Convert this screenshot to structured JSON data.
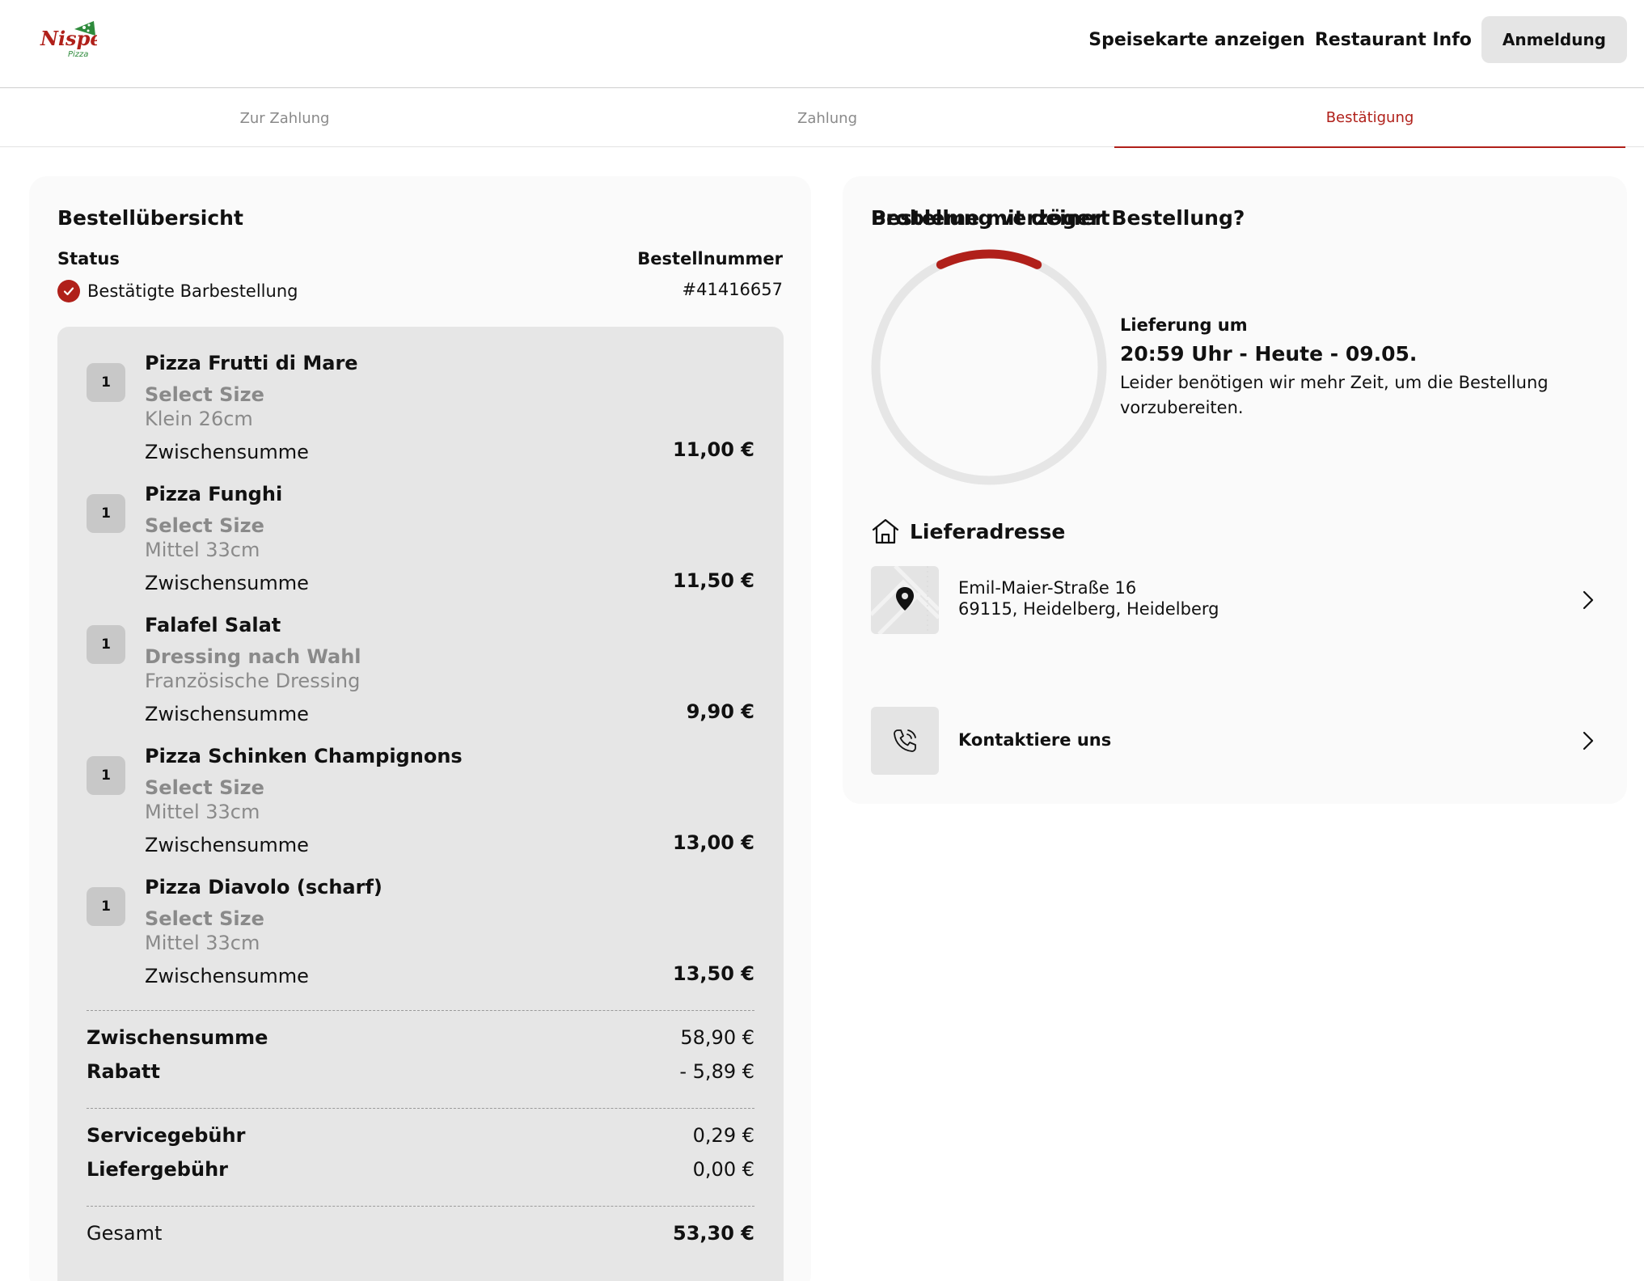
{
  "brand": {
    "logo_text": "Nispet",
    "logo_subtext": "Pizza",
    "accent": "#b0201a"
  },
  "header": {
    "nav": [
      "Speisekarte anzeigen",
      "Restaurant Info"
    ],
    "login_label": "Anmeldung"
  },
  "steps": [
    {
      "label": "Zur Zahlung",
      "active": false
    },
    {
      "label": "Zahlung",
      "active": false
    },
    {
      "label": "Bestätigung",
      "active": true
    }
  ],
  "order": {
    "title": "Bestellübersicht",
    "status_label": "Status",
    "status_value": "Bestätigte Barbestellung",
    "order_number_label": "Bestellnummer",
    "order_number": "#41416657",
    "items": [
      {
        "qty": "1",
        "name": "Pizza Frutti di Mare",
        "option_label": "Select Size",
        "option_value": "Klein 26cm",
        "subtotal_label": "Zwischensumme",
        "subtotal": "11,00 €"
      },
      {
        "qty": "1",
        "name": "Pizza Funghi",
        "option_label": "Select Size",
        "option_value": "Mittel 33cm",
        "subtotal_label": "Zwischensumme",
        "subtotal": "11,50 €"
      },
      {
        "qty": "1",
        "name": "Falafel Salat",
        "option_label": "Dressing nach Wahl",
        "option_value": "Französische Dressing",
        "subtotal_label": "Zwischensumme",
        "subtotal": "9,90 €"
      },
      {
        "qty": "1",
        "name": "Pizza Schinken Champignons",
        "option_label": "Select Size",
        "option_value": "Mittel 33cm",
        "subtotal_label": "Zwischensumme",
        "subtotal": "13,00 €"
      },
      {
        "qty": "1",
        "name": "Pizza Diavolo (scharf)",
        "option_label": "Select Size",
        "option_value": "Mittel 33cm",
        "subtotal_label": "Zwischensumme",
        "subtotal": "13,50 €"
      }
    ],
    "summary": {
      "subtotal_label": "Zwischensumme",
      "subtotal": "58,90 €",
      "discount_label": "Rabatt",
      "discount": "- 5,89 €",
      "service_label": "Servicegebühr",
      "service": "0,29 €",
      "delivery_label": "Liefergebühr",
      "delivery": "0,00 €",
      "total_label": "Gesamt",
      "total": "53,30 €"
    }
  },
  "delivery": {
    "title": "Bestellung verzögert",
    "progress_fraction": 0.14,
    "time_label": "Lieferung um",
    "time_value": "20:59 Uhr - Heute - 09.05.",
    "note": "Leider benötigen wir mehr Zeit, um die Bestellung vorzubereiten.",
    "address_title": "Lieferadresse",
    "address_line1": "Emil-Maier-Straße 16",
    "address_line2": "69115, Heidelberg, Heidelberg",
    "problem_title": "Probleme mit deiner Bestellung?",
    "contact_label": "Kontaktiere uns"
  }
}
